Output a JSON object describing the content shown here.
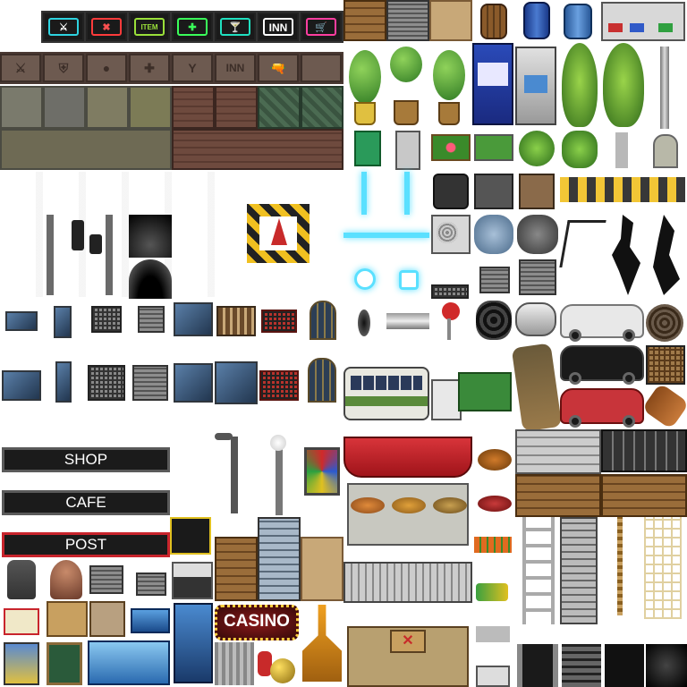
{
  "tileset": {
    "neon_signs": [
      {
        "name": "weapon",
        "color": "#2ed3e0",
        "glyph": "⚔"
      },
      {
        "name": "armor",
        "color": "#ff3b3b",
        "glyph": "✖"
      },
      {
        "name": "item",
        "color": "#9ae03a",
        "glyph": "ITEM"
      },
      {
        "name": "clinic",
        "color": "#3aff5a",
        "glyph": "✚"
      },
      {
        "name": "cocktail",
        "color": "#20e0c0",
        "glyph": "🍸"
      },
      {
        "name": "inn",
        "color": "#ffffff",
        "glyph": "INN"
      },
      {
        "name": "shop",
        "color": "#ff3ea0",
        "glyph": "🛒"
      }
    ],
    "metal_plates": [
      {
        "name": "weapon",
        "glyph": "⚔"
      },
      {
        "name": "armor",
        "glyph": "⛨"
      },
      {
        "name": "item",
        "glyph": "●"
      },
      {
        "name": "clinic",
        "glyph": "✚"
      },
      {
        "name": "bar",
        "glyph": "Y"
      },
      {
        "name": "inn",
        "glyph": "INN"
      },
      {
        "name": "gun",
        "glyph": "🔫"
      }
    ],
    "store_signs": {
      "shop": "SHOP",
      "cafe": "CAFE",
      "post": "POST"
    },
    "casino_sign": "CASINO",
    "inn_label": "INN",
    "colors": {
      "neon_frame": "#1a1a1a",
      "stall_red": "#b8242c",
      "car_white": "#e8e8e8",
      "car_black": "#1a1a1a",
      "car_red": "#c8343a",
      "tree_green": "#4f9a2c",
      "sign_red_border": "#c8242c"
    }
  }
}
